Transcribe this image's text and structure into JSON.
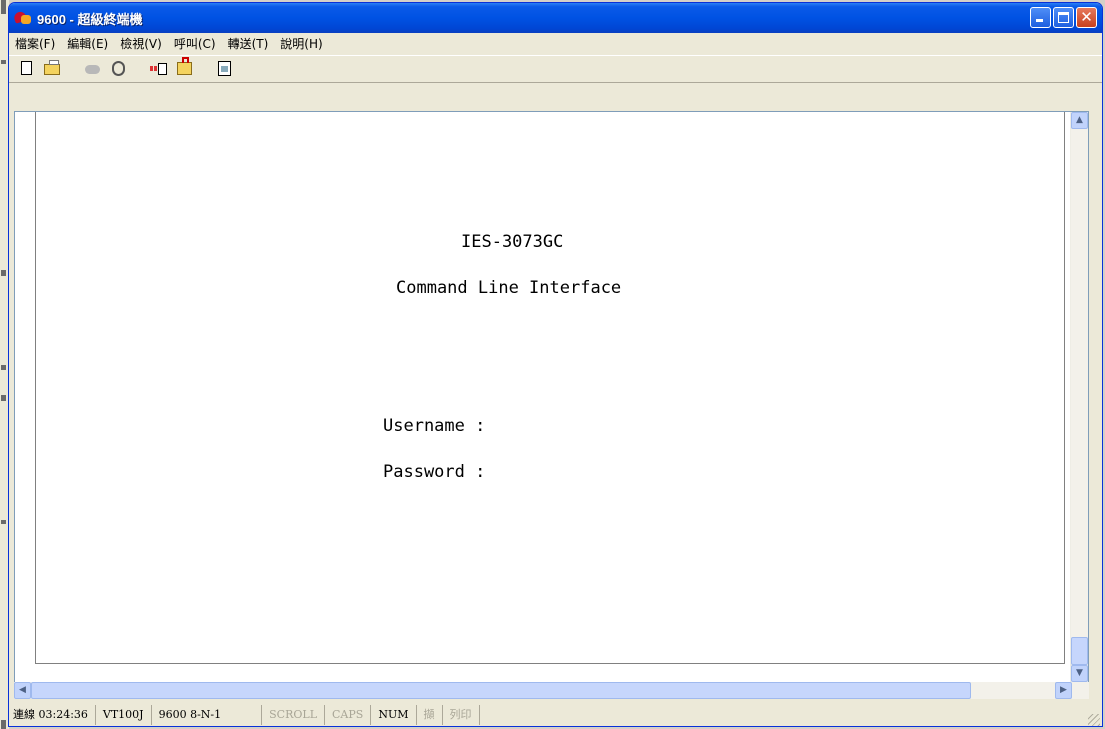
{
  "window": {
    "title": "9600 - 超級終端機"
  },
  "menu": [
    {
      "label": "檔案(F)"
    },
    {
      "label": "編輯(E)"
    },
    {
      "label": "檢視(V)"
    },
    {
      "label": "呼叫(C)"
    },
    {
      "label": "轉送(T)"
    },
    {
      "label": "說明(H)"
    }
  ],
  "toolbar": {
    "icons": [
      "new-icon",
      "open-icon",
      "call-icon",
      "disconnect-icon",
      "send-icon",
      "receive-icon",
      "properties-icon"
    ]
  },
  "terminal": {
    "lines": [
      "IES-3073GC",
      "Command Line Interface",
      "Username :",
      "Password :"
    ]
  },
  "status": {
    "connection": "連線 03:24:36",
    "emulation": "VT100J",
    "port_settings": "9600 8-N-1",
    "scroll": "SCROLL",
    "caps": "CAPS",
    "num": "NUM",
    "capture": "擷",
    "print": "列印"
  }
}
